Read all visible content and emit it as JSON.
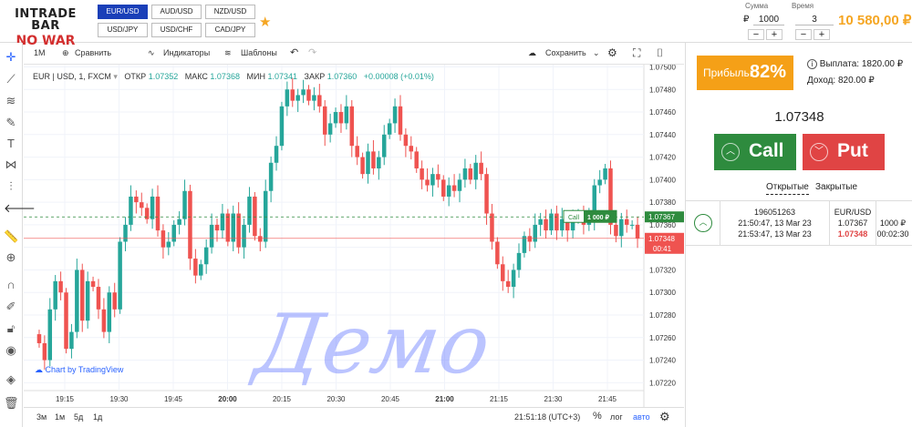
{
  "brand": {
    "line1": "INTRADE BAR",
    "line2": "NO WAR"
  },
  "pairs": [
    {
      "label": "EUR/USD",
      "active": true
    },
    {
      "label": "AUD/USD",
      "active": false
    },
    {
      "label": "NZD/USD",
      "active": false
    },
    {
      "label": "USD/JPY",
      "active": false
    },
    {
      "label": "USD/CHF",
      "active": false
    },
    {
      "label": "CAD/JPY",
      "active": false
    }
  ],
  "controls": {
    "sum_label": "Сумма",
    "currency": "₽",
    "sum_value": "1000",
    "time_label": "Время",
    "time_value": "3",
    "minus": "−",
    "plus": "+",
    "balance": "10 580,00 ₽"
  },
  "toolbar": {
    "interval": "1M",
    "compare": "Сравнить",
    "indicators": "Индикаторы",
    "templates": "Шаблоны",
    "save": "Сохранить"
  },
  "chart_header": {
    "symbol": "EUR | USD, 1, FXCM",
    "open_label": "ОТКР",
    "open": "1.07352",
    "high_label": "МАКС",
    "high": "1.07368",
    "low_label": "МИН",
    "low": "1.07341",
    "close_label": "ЗАКР",
    "close": "1.07360",
    "change": "+0.00008 (+0.01%)"
  },
  "watermark": "Chart by TradingView",
  "demo_text": "Демо",
  "chart_data": {
    "type": "candlestick",
    "x_ticks": [
      "19:15",
      "19:30",
      "19:45",
      "20:00",
      "20:15",
      "20:30",
      "20:45",
      "21:00",
      "21:15",
      "21:30",
      "21:45"
    ],
    "x_ticks_bold": [
      "20:00",
      "21:00"
    ],
    "y_ticks": [
      "1.07500",
      "1.07480",
      "1.07460",
      "1.07440",
      "1.07420",
      "1.07400",
      "1.07380",
      "1.07360",
      "1.07340",
      "1.07320",
      "1.07300",
      "1.07280",
      "1.07260",
      "1.07240",
      "1.07220"
    ],
    "ylim": [
      1.07213,
      1.07502
    ],
    "current_price": "1.07348",
    "countdown": "00:41",
    "trade_line_price": "1.07367",
    "trade_tag": {
      "label": "Call",
      "amount": "1 000 ₽"
    },
    "closes": [
      1.07255,
      1.0724,
      1.07285,
      1.0731,
      1.073,
      1.0725,
      1.07265,
      1.0732,
      1.07275,
      1.0731,
      1.07305,
      1.07285,
      1.07265,
      1.073,
      1.07285,
      1.07345,
      1.0736,
      1.07385,
      1.0738,
      1.07375,
      1.07365,
      1.07385,
      1.07355,
      1.0734,
      1.07345,
      1.0736,
      1.07365,
      1.0739,
      1.0733,
      1.07315,
      1.07325,
      1.0734,
      1.0736,
      1.07355,
      1.0737,
      1.07345,
      1.0737,
      1.0734,
      1.0736,
      1.07385,
      1.0735,
      1.07345,
      1.0739,
      1.07415,
      1.0743,
      1.07465,
      1.0748,
      1.0747,
      1.07475,
      1.0748,
      1.0747,
      1.07475,
      1.07465,
      1.0744,
      1.0745,
      1.0746,
      1.0745,
      1.07465,
      1.0743,
      1.0742,
      1.07405,
      1.07425,
      1.0741,
      1.0742,
      1.0744,
      1.0745,
      1.07465,
      1.0744,
      1.0743,
      1.07425,
      1.0741,
      1.074,
      1.07395,
      1.07405,
      1.074,
      1.07385,
      1.07395,
      1.0739,
      1.074,
      1.0741,
      1.074,
      1.07415,
      1.07405,
      1.0737,
      1.07345,
      1.07325,
      1.0731,
      1.07305,
      1.0732,
      1.07335,
      1.0735,
      1.07345,
      1.0736,
      1.07365,
      1.07355,
      1.0737,
      1.07355,
      1.07365,
      1.07355,
      1.07365,
      1.0737,
      1.0736,
      1.07365,
      1.07395,
      1.074,
      1.0741,
      1.0736,
      1.0735,
      1.07365,
      1.0736,
      1.0736,
      1.07348
    ]
  },
  "bottombar": {
    "ranges": [
      "3м",
      "1м",
      "5д",
      "1д"
    ],
    "clock": "21:51:18 (UTC+3)",
    "percent": "%",
    "log": "лог",
    "auto": "авто"
  },
  "panel": {
    "profit_label": "Прибыль:",
    "profit_value": "82%",
    "payout": "Выплата: 1820.00 ₽",
    "income": "Доход: 820.00 ₽",
    "price": "1.07348",
    "call_label": "Call",
    "put_label": "Put",
    "tab_open": "Открытые",
    "tab_closed": "Закрытые",
    "trade": {
      "id": "196051263",
      "open_time": "21:50:47, 13 Mar 23",
      "close_time": "21:53:47, 13 Mar 23",
      "pair": "EUR/USD",
      "open_price": "1.07367",
      "close_price": "1.07348",
      "amount": "1000 ₽",
      "remaining": "00:02:30"
    }
  },
  "colors": {
    "up": "#26a69a",
    "down": "#ef5350",
    "accent": "#f5a017",
    "call": "#2e8b3e",
    "put": "#e04444"
  }
}
